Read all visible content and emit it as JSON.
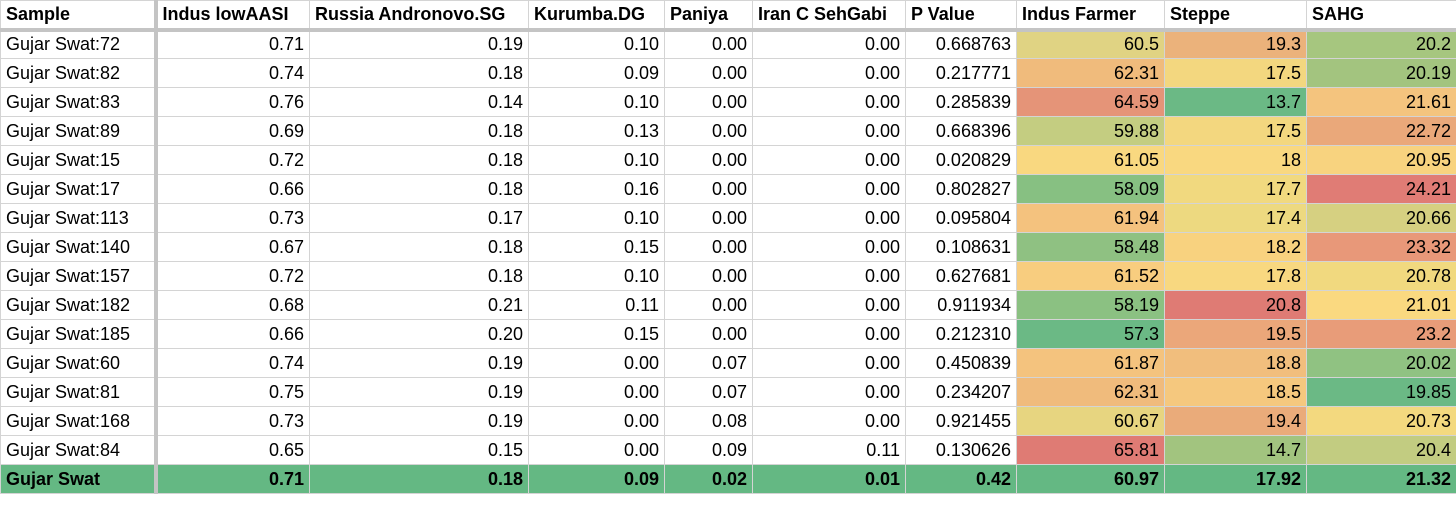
{
  "headers": [
    "Sample",
    "Indus lowAASI",
    "Russia Andronovo.SG",
    "Kurumba.DG",
    "Paniya",
    "Iran C SehGabi",
    "P Value",
    "Indus Farmer",
    "Steppe",
    "SAHG"
  ],
  "rows": [
    {
      "cells": [
        "Gujar Swat:72",
        "0.71",
        "0.19",
        "0.10",
        "0.00",
        "0.00",
        "0.668763",
        "60.5",
        "19.3",
        "20.2"
      ],
      "colors": [
        "#e0d383",
        "#ebb27b",
        "#a6c67f"
      ]
    },
    {
      "cells": [
        "Gujar Swat:82",
        "0.74",
        "0.18",
        "0.09",
        "0.00",
        "0.00",
        "0.217771",
        "62.31",
        "17.5",
        "20.19"
      ],
      "colors": [
        "#f0bb7c",
        "#f3d77f",
        "#a3c47f"
      ]
    },
    {
      "cells": [
        "Gujar Swat:83",
        "0.76",
        "0.14",
        "0.10",
        "0.00",
        "0.00",
        "0.285839",
        "64.59",
        "13.7",
        "21.61"
      ],
      "colors": [
        "#e59478",
        "#6bb985",
        "#f4c47e"
      ]
    },
    {
      "cells": [
        "Gujar Swat:89",
        "0.69",
        "0.18",
        "0.13",
        "0.00",
        "0.00",
        "0.668396",
        "59.88",
        "17.5",
        "22.72"
      ],
      "colors": [
        "#c4cd81",
        "#f3d77f",
        "#eaa87a"
      ]
    },
    {
      "cells": [
        "Gujar Swat:15",
        "0.72",
        "0.18",
        "0.10",
        "0.00",
        "0.00",
        "0.020829",
        "61.05",
        "18",
        "20.95"
      ],
      "colors": [
        "#f9d880",
        "#f9d880",
        "#f8d37f"
      ]
    },
    {
      "cells": [
        "Gujar Swat:17",
        "0.66",
        "0.18",
        "0.16",
        "0.00",
        "0.00",
        "0.802827",
        "58.09",
        "17.7",
        "24.21"
      ],
      "colors": [
        "#87c082",
        "#f1d97f",
        "#e07c75"
      ]
    },
    {
      "cells": [
        "Gujar Swat:113",
        "0.73",
        "0.17",
        "0.10",
        "0.00",
        "0.00",
        "0.095804",
        "61.94",
        "17.4",
        "20.66"
      ],
      "colors": [
        "#f4c27e",
        "#edd980",
        "#d6d081"
      ]
    },
    {
      "cells": [
        "Gujar Swat:140",
        "0.67",
        "0.18",
        "0.15",
        "0.00",
        "0.00",
        "0.108631",
        "58.48",
        "18.2",
        "23.32"
      ],
      "colors": [
        "#8fc182",
        "#f8d27f",
        "#e89879"
      ]
    },
    {
      "cells": [
        "Gujar Swat:157",
        "0.72",
        "0.18",
        "0.10",
        "0.00",
        "0.00",
        "0.627681",
        "61.52",
        "17.8",
        "20.78"
      ],
      "colors": [
        "#f8cd7f",
        "#f8d880",
        "#f1d97f"
      ]
    },
    {
      "cells": [
        "Gujar Swat:182",
        "0.68",
        "0.21",
        "0.11",
        "0.00",
        "0.00",
        "0.911934",
        "58.19",
        "20.8",
        "21.01"
      ],
      "colors": [
        "#8bc182",
        "#df7b74",
        "#fad980"
      ]
    },
    {
      "cells": [
        "Gujar Swat:185",
        "0.66",
        "0.20",
        "0.15",
        "0.00",
        "0.00",
        "0.212310",
        "57.3",
        "19.5",
        "23.2"
      ],
      "colors": [
        "#6bb985",
        "#eba77a",
        "#e89c79"
      ]
    },
    {
      "cells": [
        "Gujar Swat:60",
        "0.74",
        "0.19",
        "0.00",
        "0.07",
        "0.00",
        "0.450839",
        "61.87",
        "18.8",
        "20.02"
      ],
      "colors": [
        "#f4c37e",
        "#f1be7d",
        "#90c282"
      ]
    },
    {
      "cells": [
        "Gujar Swat:81",
        "0.75",
        "0.19",
        "0.00",
        "0.07",
        "0.00",
        "0.234207",
        "62.31",
        "18.5",
        "19.85"
      ],
      "colors": [
        "#f0bb7c",
        "#f5c87e",
        "#6bb985"
      ]
    },
    {
      "cells": [
        "Gujar Swat:168",
        "0.73",
        "0.19",
        "0.00",
        "0.08",
        "0.00",
        "0.921455",
        "60.67",
        "19.4",
        "20.73"
      ],
      "colors": [
        "#e7d580",
        "#eaab7a",
        "#f3d97f"
      ]
    },
    {
      "cells": [
        "Gujar Swat:84",
        "0.65",
        "0.15",
        "0.00",
        "0.09",
        "0.11",
        "0.130626",
        "65.81",
        "14.7",
        "20.4"
      ],
      "colors": [
        "#df7b74",
        "#a2c47f",
        "#c2cc81"
      ]
    }
  ],
  "total": {
    "cells": [
      "Gujar Swat",
      "0.71",
      "0.18",
      "0.09",
      "0.02",
      "0.01",
      "0.42",
      "60.97",
      "17.92",
      "21.32"
    ]
  }
}
